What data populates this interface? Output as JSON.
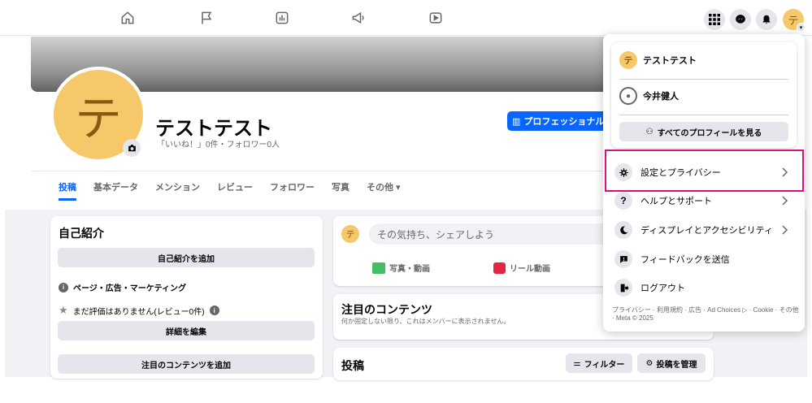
{
  "profile": {
    "name": "テストテスト",
    "avatar_char": "テ",
    "stats": "「いいね！」0件・フォロワー0人",
    "pro_button": "プロフェッショナル"
  },
  "tabs": [
    "投稿",
    "基本データ",
    "メンション",
    "レビュー",
    "フォロワー",
    "写真",
    "その他 ▾"
  ],
  "intro": {
    "title": "自己紹介",
    "add_intro": "自己紹介を追加",
    "page_info": "ページ・広告・マーケティング",
    "rating": "まだ評価はありません(レビュー0件)",
    "edit_details": "詳細を編集",
    "add_featured": "注目のコンテンツを追加"
  },
  "composer": {
    "placeholder": "その気持ち、シェアしよう",
    "photo_video": "写真・動画",
    "reel": "リール動画"
  },
  "featured": {
    "title": "注目のコンテンツ",
    "subtitle": "何か固定しない限り、これはメンバーに表示されません。"
  },
  "posts": {
    "title": "投稿",
    "filter": "フィルター",
    "manage": "投稿を管理"
  },
  "dropdown": {
    "account1": "テストテスト",
    "account2": "今井健人",
    "see_all": "すべてのプロフィールを見る",
    "items": [
      {
        "label": "設定とプライバシー",
        "icon": "gear-icon",
        "chevron": true
      },
      {
        "label": "ヘルプとサポート",
        "icon": "help-icon",
        "chevron": true
      },
      {
        "label": "ディスプレイとアクセシビリティ",
        "icon": "moon-icon",
        "chevron": true
      },
      {
        "label": "フィードバックを送信",
        "icon": "feedback-icon",
        "chevron": false
      },
      {
        "label": "ログアウト",
        "icon": "logout-icon",
        "chevron": false
      }
    ],
    "footer": "プライバシー · 利用規約 · 広告 · Ad Choices ▷ · Cookie · その他 · Meta © 2025"
  },
  "colors": {
    "accent": "#0866ff",
    "highlight": "#d9107a",
    "avatar": "#f5c96a"
  }
}
